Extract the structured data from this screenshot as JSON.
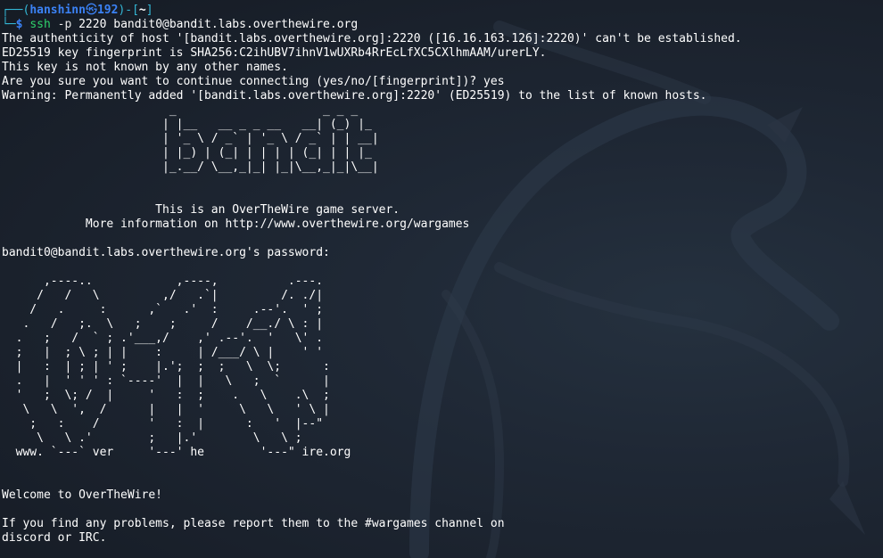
{
  "prompt": {
    "frame_top": "┌──(",
    "user": "hanshinn",
    "skull": "㉿",
    "host": "192",
    "frame_mid": ")-[",
    "dir": "~",
    "frame_end": "]",
    "frame_bottom": "└─",
    "dollar": "$",
    "command": "ssh",
    "flag": "-p",
    "args": "2220 bandit0@bandit.labs.overthewire.org"
  },
  "ssh_output": [
    "The authenticity of host '[bandit.labs.overthewire.org]:2220 ([16.16.163.126]:2220)' can't be established.",
    "ED25519 key fingerprint is SHA256:C2ihUBV7ihnV1wUXRb4RrEcLfXC5CXlhmAAM/urerLY.",
    "This key is not known by any other names.",
    "Are you sure you want to continue connecting (yes/no/[fingerprint])? yes",
    "Warning: Permanently added '[bandit.labs.overthewire.org]:2220' (ED25519) to the list of known hosts."
  ],
  "banner_art": "                        _                     _ _ _   \n                       | |__   __ _ _ __   __| (_) |_ \n                       | '_ \\ / _` | '_ \\ / _` | | __|\n                       | |_) | (_| | | | | (_| | | |_ \n                       |_.__/ \\__,_|_| |_|\\__,_|_|\\__|",
  "server_info": [
    "                      This is an OverTheWire game server.",
    "            More information on http://www.overthewire.org/wargames"
  ],
  "password_prompt": "bandit0@bandit.labs.overthewire.org's password:",
  "otw_art": "      ,----..            ,----,          .---.\n     /   /   \\         ,/   .`|         /. ./|\n    /   .     :      ,`   .'  :     .--'.  ' ;\n   .   /   ;.  \\   ;    ;     /    /__./ \\ : |\n  .   ;   /  ` ; .'___,/    ,' .--'.  '   \\' .\n  ;   |  ; \\ ; | |    :     | /___/ \\ |    ' '\n  |   :  | ; | ' ;    |.';  ;  ;   \\  \\;      :\n  .   |  ' ' ' : `----'  |  |   \\   ;  `      |\n  '   ;  \\; /  |     '   :  ;    .   \\    .\\  ;\n   \\   \\  ',  /      |   |  '     \\   \\   ' \\ |\n    ;   :    /       '   :  |      :   '  |--\"\n     \\   \\ .'        ;   |.'        \\   \\ ;\n  www. `---` ver     '---' he        '---\" ire.org",
  "welcome": "Welcome to OverTheWire!",
  "help_lines": [
    "If you find any problems, please report them to the #wargames channel on",
    "discord or IRC."
  ]
}
